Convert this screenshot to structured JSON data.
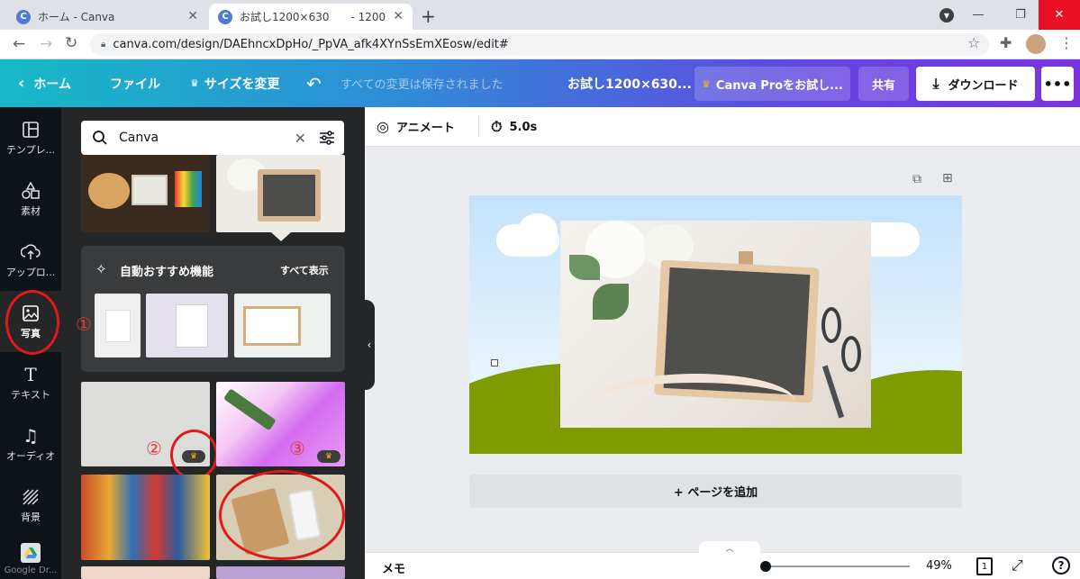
{
  "browser": {
    "tabs": [
      {
        "title": "ホーム - Canva"
      },
      {
        "title": "お試し1200×630　　- 1200"
      }
    ],
    "url": "canva.com/design/DAEhncxDpHo/_PpVA_afk4XYnSsEmXEosw/edit#"
  },
  "header": {
    "home": "ホーム",
    "file": "ファイル",
    "resize": "サイズを変更",
    "saved_status": "すべての変更は保存されました",
    "doc_title": "お試し1200×630...",
    "try_pro": "Canva Proをお試し...",
    "share": "共有",
    "download": "ダウンロード"
  },
  "rail": {
    "items": [
      {
        "label": "テンプレ..."
      },
      {
        "label": "素材"
      },
      {
        "label": "アップロ..."
      },
      {
        "label": "写真"
      },
      {
        "label": "テキスト"
      },
      {
        "label": "オーディオ"
      },
      {
        "label": "背景"
      },
      {
        "label": "Google Dr..."
      }
    ]
  },
  "panel": {
    "search_value": "Canva",
    "suggest_title": "自動おすすめ機能",
    "see_all": "すべて表示"
  },
  "annotations": {
    "n1": "①",
    "n2": "②",
    "n3": "③"
  },
  "toolbar": {
    "animate": "アニメート",
    "duration": "5.0s"
  },
  "canvas": {
    "add_page": "+ ページを追加"
  },
  "bottom": {
    "notes": "メモ",
    "zoom": "49%",
    "page_num": "1",
    "help": "?"
  },
  "colors": {
    "accent_purple": "#7a34df",
    "accent_teal": "#17b9c8",
    "annotation_red": "#e01a1a",
    "hill_green": "#7f9b00"
  }
}
